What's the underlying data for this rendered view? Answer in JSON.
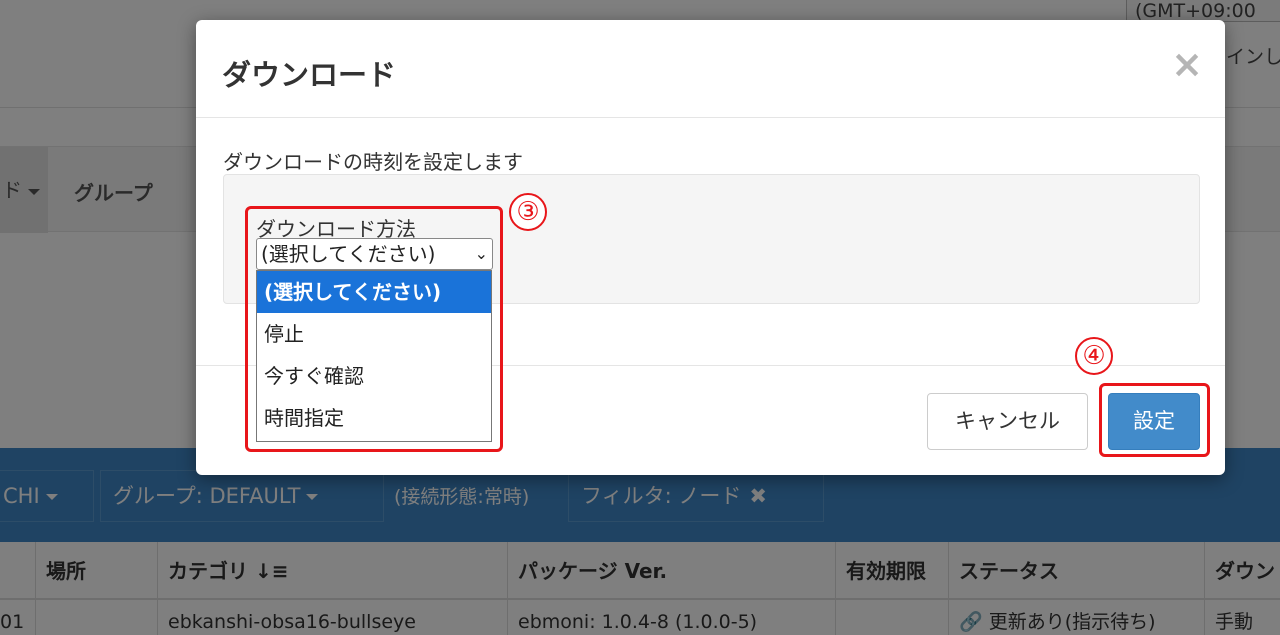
{
  "background": {
    "timezone": "(GMT+09:00",
    "login_fragment": "インし",
    "nav_active_caret": "ド",
    "nav_group": "グループ",
    "filter_pills": {
      "user": "CHI",
      "group": "グループ: DEFAULT",
      "connection": "(接続形態:常時)",
      "filter": "フィルタ: ノード"
    },
    "table": {
      "headers": [
        "",
        "場所",
        "カテゴリ ↓≡",
        "パッケージ Ver.",
        "有効期限",
        "ステータス",
        "ダウン"
      ],
      "row": [
        "01",
        "",
        "ebkanshi-obsa16-bullseye",
        "ebmoni: 1.0.4-8 (1.0.0-5)",
        "",
        "🔗 更新あり(指示待ち)",
        "手動"
      ]
    }
  },
  "modal": {
    "title": "ダウンロード",
    "close": "×",
    "description": "ダウンロードの時刻を設定します",
    "method_label": "ダウンロード方法",
    "method_selected": "(選択してください)",
    "method_options": [
      "(選択してください)",
      "停止",
      "今すぐ確認",
      "時間指定"
    ],
    "cancel_label": "キャンセル",
    "submit_label": "設定"
  },
  "annotations": {
    "marker_a": "③",
    "marker_b": "④",
    "color": "#e8161a"
  }
}
